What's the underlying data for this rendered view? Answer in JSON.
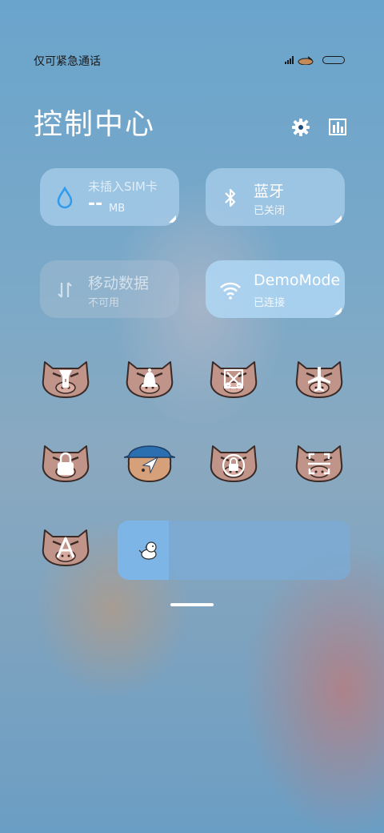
{
  "status_bar": {
    "carrier": "仅可紧急通话",
    "icons": [
      "signal-icon",
      "crayon-mascot-icon",
      "battery-icon"
    ]
  },
  "header": {
    "title": "控制中心",
    "icons": [
      "gear-icon",
      "bar-chart-icon"
    ]
  },
  "tiles": [
    {
      "name": "sim-data",
      "title": "未插入SIM卡",
      "value": "--",
      "unit": "MB",
      "icon": "water-drop-icon",
      "state": "on"
    },
    {
      "name": "bluetooth",
      "title": "蓝牙",
      "subtitle": "已关闭",
      "icon": "bluetooth-icon",
      "state": "on"
    },
    {
      "name": "mobile-data",
      "title": "移动数据",
      "subtitle": "不可用",
      "icon": "data-arrows-icon",
      "state": "disabled"
    },
    {
      "name": "wifi",
      "title": "DemoMode",
      "subtitle": "已连接",
      "icon": "wifi-icon",
      "state": "active"
    }
  ],
  "toggles": [
    {
      "name": "flashlight",
      "icon": "flashlight-icon"
    },
    {
      "name": "sound",
      "icon": "bell-icon"
    },
    {
      "name": "screenshot",
      "icon": "screenshot-icon"
    },
    {
      "name": "airplane",
      "icon": "airplane-icon"
    },
    {
      "name": "lock-screen",
      "icon": "lock-icon"
    },
    {
      "name": "location",
      "icon": "location-arrow-icon"
    },
    {
      "name": "rotation-lock",
      "icon": "rotation-lock-icon"
    },
    {
      "name": "scanner",
      "icon": "scan-icon"
    },
    {
      "name": "auto-brightness",
      "icon": "auto-a-icon",
      "label": "A"
    }
  ],
  "brightness": {
    "level": 0.22,
    "icon": "dog-brightness-icon"
  },
  "colors": {
    "accent": "#7db6e6",
    "pig": "#c09488"
  }
}
